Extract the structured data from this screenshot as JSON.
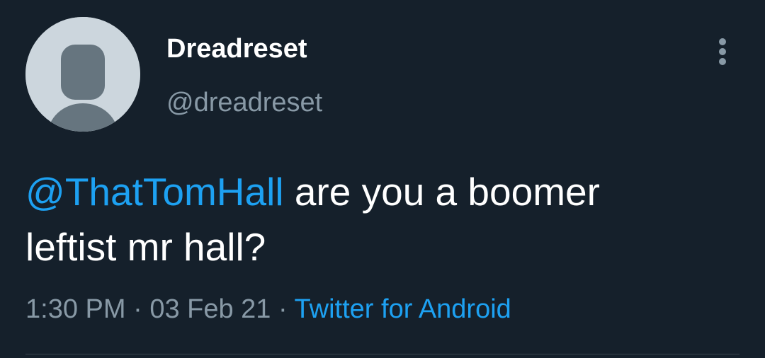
{
  "author": {
    "display_name": "Dreadreset",
    "handle": "@dreadreset",
    "avatar_icon": "default-profile-avatar-icon"
  },
  "tweet": {
    "mention": "@ThatTomHall",
    "text_part1": " are you a boomer",
    "text_part2": "leftist mr hall?"
  },
  "meta": {
    "time": "1:30 PM",
    "separator1": " · ",
    "date": "03 Feb 21",
    "separator2": " · ",
    "source": "Twitter for Android"
  },
  "menu": {
    "icon": "more-vertical-icon"
  },
  "colors": {
    "background": "#15202b",
    "accent": "#1da1f2",
    "primary_text": "#ffffff",
    "secondary_text": "#8899a6",
    "divider": "#38444d"
  }
}
